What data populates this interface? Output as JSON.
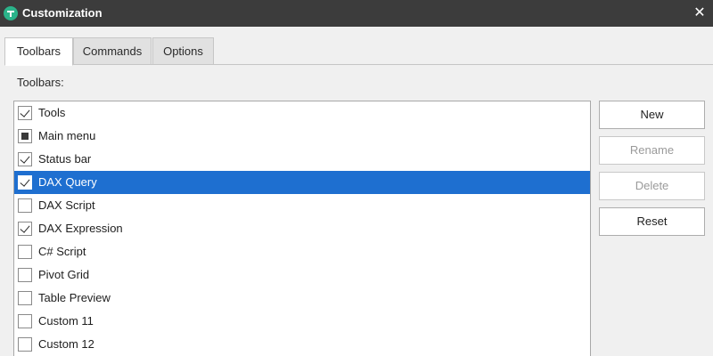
{
  "window": {
    "title": "Customization",
    "close_glyph": "✕",
    "icon": "app-logo-icon",
    "accent": "#1e6fd0"
  },
  "tabs": [
    {
      "label": "Toolbars",
      "active": true
    },
    {
      "label": "Commands",
      "active": false
    },
    {
      "label": "Options",
      "active": false
    }
  ],
  "toolbars_label": "Toolbars:",
  "list": [
    {
      "label": "Tools",
      "state": "checked",
      "selected": false
    },
    {
      "label": "Main menu",
      "state": "indeterminate",
      "selected": false
    },
    {
      "label": "Status bar",
      "state": "checked",
      "selected": false
    },
    {
      "label": "DAX Query",
      "state": "checked",
      "selected": true
    },
    {
      "label": "DAX Script",
      "state": "unchecked",
      "selected": false
    },
    {
      "label": "DAX Expression",
      "state": "checked",
      "selected": false
    },
    {
      "label": "C# Script",
      "state": "unchecked",
      "selected": false
    },
    {
      "label": "Pivot Grid",
      "state": "unchecked",
      "selected": false
    },
    {
      "label": "Table Preview",
      "state": "unchecked",
      "selected": false
    },
    {
      "label": "Custom 11",
      "state": "unchecked",
      "selected": false
    },
    {
      "label": "Custom 12",
      "state": "unchecked",
      "selected": false
    }
  ],
  "buttons": {
    "new": {
      "label": "New",
      "enabled": true
    },
    "rename": {
      "label": "Rename",
      "enabled": false
    },
    "delete": {
      "label": "Delete",
      "enabled": false
    },
    "reset": {
      "label": "Reset",
      "enabled": true
    }
  }
}
